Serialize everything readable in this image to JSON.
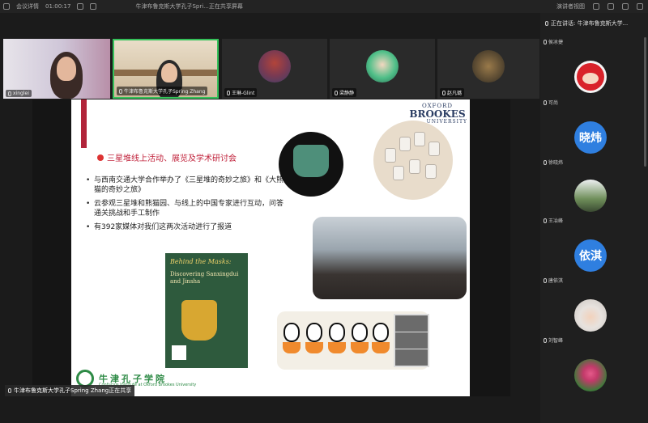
{
  "topbar": {
    "meeting_label": "会议详情",
    "timer": "01:00:17",
    "share_title": "牛津布鲁克斯大学孔子Spri...正在共享屏幕",
    "right_view_label": "演讲者视图",
    "right_settings_label": "设置"
  },
  "speaking": {
    "label": "正在讲话: 牛津布鲁克斯大学..."
  },
  "strip": [
    {
      "name": "xinglei"
    },
    {
      "name": "牛津布鲁克斯大学孔子Spring Zhang"
    },
    {
      "name": "王琳-Glint"
    },
    {
      "name": "梁静静"
    },
    {
      "name": "赵凡璐"
    }
  ],
  "right_panel": [
    {
      "name": "侯冰捷",
      "avatar_text": ""
    },
    {
      "name": "可尚",
      "avatar_text": ""
    },
    {
      "name": "徐晓炜",
      "avatar_text": "晓炜"
    },
    {
      "name": "王冶峰",
      "avatar_text": ""
    },
    {
      "name": "唐依淇",
      "avatar_text": "依淇"
    },
    {
      "name": "刘智峰",
      "avatar_text": ""
    },
    {
      "name": "",
      "avatar_text": ""
    }
  ],
  "slide": {
    "oxford_line1": "OXFORD",
    "oxford_line2": "BROOKES",
    "oxford_line3": "UNIVERSITY",
    "title": "三星堆线上活动、展览及学术研讨会",
    "bullets": [
      "与西南交通大学合作举办了《三星堆的奇妙之旅》和《大熊猫的奇妙之旅》",
      "云参观三星堆和熊猫园、与线上的中国专家进行互动，问答通关挑战和手工制作",
      "有392家媒体对我们这两次活动进行了报道"
    ],
    "poster_title": "Behind the Masks:",
    "poster_sub": "Discovering Sanxingdui and Jinsha",
    "ci_name": "牛津孔子学院",
    "ci_sub": "Confucius Institute at Oxford Brookes University"
  },
  "share_tag": "牛津布鲁克斯大学孔子Spring Zhang正在共享",
  "colors": {
    "accent_red": "#c0213a",
    "ci_green": "#2d8a45",
    "active_speaker": "#35c15a",
    "avatar_blue": "#2f7fe0"
  }
}
